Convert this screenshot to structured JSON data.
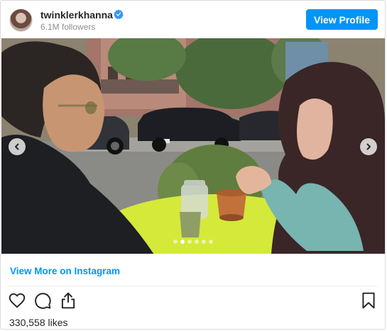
{
  "header": {
    "username": "twinklerkhanna",
    "followers": "6.1M followers",
    "view_profile_label": "View Profile"
  },
  "post": {
    "image_alt": "Two people talking at an outdoor cafe table on a city street",
    "carousel": {
      "total": 6,
      "active": 1
    }
  },
  "links": {
    "view_more": "View More on Instagram"
  },
  "actions": [
    "heart-icon",
    "comment-icon",
    "share-icon",
    "bookmark-icon"
  ],
  "stats": {
    "likes": "330,558 likes"
  },
  "colors": {
    "accent": "#0095f6",
    "verified": "#3897f0"
  }
}
